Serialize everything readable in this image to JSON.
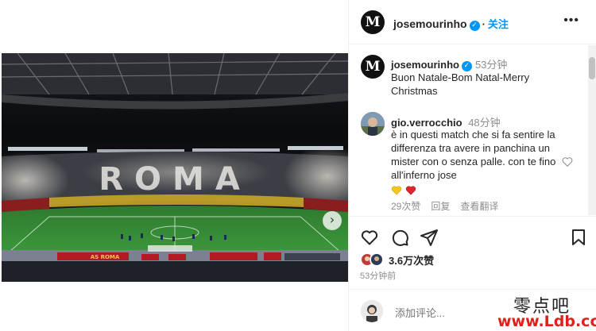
{
  "post": {
    "username": "josemourinho",
    "follow_label": "关注",
    "logo_letter": "M",
    "more_icon": "more-horizontal-icon"
  },
  "caption": {
    "username": "josemourinho",
    "time": "53分钟",
    "text": "Buon Natale-Bom Natal-Merry Christmas"
  },
  "comment": {
    "username": "gio.verrocchio",
    "time": "48分钟",
    "text": "è in questi match che si fa sentire la differenza tra avere in panchina un mister con o senza palle. con te fino all'inferno jose",
    "likes": "29次赞",
    "reply_label": "回复",
    "translate_label": "查看翻译"
  },
  "photo": {
    "banner_text": "ROMA",
    "sponsor_text": "AS ROMA",
    "carousel_dots": 5,
    "active_dot": 1
  },
  "actions": {
    "likes_count": "3.6万次赞",
    "post_time": "53分钟前"
  },
  "add_comment": {
    "placeholder": "添加评论..."
  },
  "watermark": {
    "cn_text": "零点吧",
    "en_text": "www.Ldb.cc"
  },
  "colors": {
    "accent": "#0095f6",
    "active_dot": "#1c8fff",
    "watermark_red": "#e0201a"
  }
}
